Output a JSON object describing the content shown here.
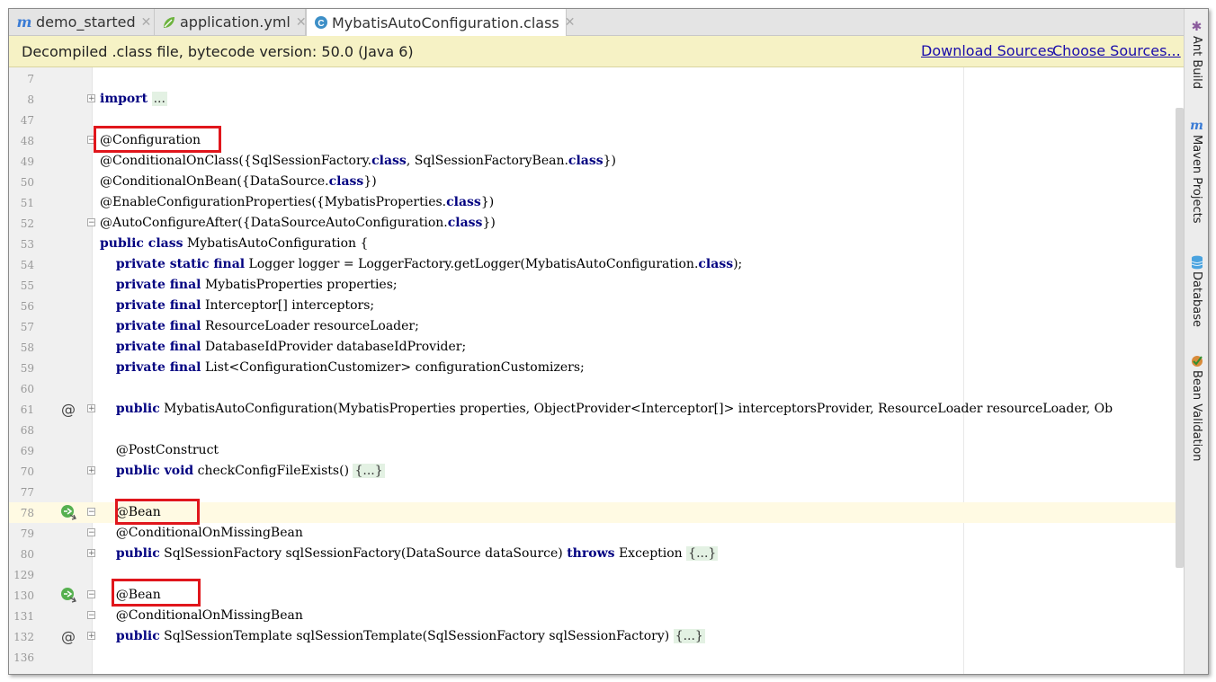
{
  "tabs": [
    {
      "label": "demo_started",
      "icon": "maven-module-icon"
    },
    {
      "label": "application.yml",
      "icon": "spring-config-icon"
    },
    {
      "label": "MybatisAutoConfiguration.class",
      "icon": "class-file-icon"
    }
  ],
  "banner": {
    "message": "Decompiled .class file, bytecode version: 50.0 (Java 6)",
    "download_sources": "Download Sources",
    "choose_sources": "Choose Sources..."
  },
  "right_tools": [
    {
      "label": "Ant Build"
    },
    {
      "label": "Maven Projects"
    },
    {
      "label": "Database"
    },
    {
      "label": "Bean Validation"
    }
  ],
  "lines": [
    {
      "num": "7"
    },
    {
      "num": "8",
      "seg": [
        [
          "kw",
          "import"
        ],
        [
          "p",
          " "
        ],
        [
          "fold",
          "..."
        ]
      ],
      "fold": "+"
    },
    {
      "num": "47"
    },
    {
      "num": "48",
      "seg": [
        [
          "p",
          "@Configuration"
        ]
      ],
      "fold": "-"
    },
    {
      "num": "49",
      "seg": [
        [
          "p",
          "@ConditionalOnClass({SqlSessionFactory."
        ],
        [
          "kw",
          "class"
        ],
        [
          "p",
          ", SqlSessionFactoryBean."
        ],
        [
          "kw",
          "class"
        ],
        [
          "p",
          "})"
        ]
      ]
    },
    {
      "num": "50",
      "seg": [
        [
          "p",
          "@ConditionalOnBean({DataSource."
        ],
        [
          "kw",
          "class"
        ],
        [
          "p",
          "})"
        ]
      ]
    },
    {
      "num": "51",
      "seg": [
        [
          "p",
          "@EnableConfigurationProperties({MybatisProperties."
        ],
        [
          "kw",
          "class"
        ],
        [
          "p",
          "})"
        ]
      ]
    },
    {
      "num": "52",
      "seg": [
        [
          "p",
          "@AutoConfigureAfter({DataSourceAutoConfiguration."
        ],
        [
          "kw",
          "class"
        ],
        [
          "p",
          "})"
        ]
      ],
      "fold": "-"
    },
    {
      "num": "53",
      "seg": [
        [
          "kw",
          "public class"
        ],
        [
          "p",
          " MybatisAutoConfiguration {"
        ]
      ]
    },
    {
      "num": "54",
      "seg": [
        [
          "p",
          "    "
        ],
        [
          "kw",
          "private static final"
        ],
        [
          "p",
          " Logger logger = LoggerFactory.getLogger(MybatisAutoConfiguration."
        ],
        [
          "kw",
          "class"
        ],
        [
          "p",
          ");"
        ]
      ]
    },
    {
      "num": "55",
      "seg": [
        [
          "p",
          "    "
        ],
        [
          "kw",
          "private final"
        ],
        [
          "p",
          " MybatisProperties properties;"
        ]
      ]
    },
    {
      "num": "56",
      "seg": [
        [
          "p",
          "    "
        ],
        [
          "kw",
          "private final"
        ],
        [
          "p",
          " Interceptor[] interceptors;"
        ]
      ]
    },
    {
      "num": "57",
      "seg": [
        [
          "p",
          "    "
        ],
        [
          "kw",
          "private final"
        ],
        [
          "p",
          " ResourceLoader resourceLoader;"
        ]
      ]
    },
    {
      "num": "58",
      "seg": [
        [
          "p",
          "    "
        ],
        [
          "kw",
          "private final"
        ],
        [
          "p",
          " DatabaseIdProvider databaseIdProvider;"
        ]
      ]
    },
    {
      "num": "59",
      "seg": [
        [
          "p",
          "    "
        ],
        [
          "kw",
          "private final"
        ],
        [
          "p",
          " List<ConfigurationCustomizer> configurationCustomizers;"
        ]
      ]
    },
    {
      "num": "60"
    },
    {
      "num": "61",
      "seg": [
        [
          "p",
          "    "
        ],
        [
          "kw",
          "public"
        ],
        [
          "p",
          " MybatisAutoConfiguration(MybatisProperties properties, ObjectProvider<Interceptor[]> interceptorsProvider, ResourceLoader resourceLoader, Ob"
        ]
      ],
      "fold": "+",
      "mark": "@"
    },
    {
      "num": "68"
    },
    {
      "num": "69",
      "seg": [
        [
          "p",
          "    @PostConstruct"
        ]
      ]
    },
    {
      "num": "70",
      "seg": [
        [
          "p",
          "    "
        ],
        [
          "kw",
          "public void"
        ],
        [
          "p",
          " checkConfigFileExists() "
        ],
        [
          "fold",
          "{...}"
        ]
      ],
      "fold": "+"
    },
    {
      "num": "77"
    },
    {
      "num": "78",
      "seg": [
        [
          "p",
          "    @Bean"
        ]
      ],
      "fold": "-",
      "mark": "bean",
      "hl": true
    },
    {
      "num": "79",
      "seg": [
        [
          "p",
          "    @ConditionalOnMissingBean"
        ]
      ],
      "fold": "-"
    },
    {
      "num": "80",
      "seg": [
        [
          "p",
          "    "
        ],
        [
          "kw",
          "public"
        ],
        [
          "p",
          " SqlSessionFactory sqlSessionFactory(DataSource dataSource) "
        ],
        [
          "kw",
          "throws"
        ],
        [
          "p",
          " Exception "
        ],
        [
          "fold",
          "{...}"
        ]
      ],
      "fold": "+"
    },
    {
      "num": "129"
    },
    {
      "num": "130",
      "seg": [
        [
          "p",
          "    @Bean"
        ]
      ],
      "fold": "-",
      "mark": "bean"
    },
    {
      "num": "131",
      "seg": [
        [
          "p",
          "    @ConditionalOnMissingBean"
        ]
      ],
      "fold": "-"
    },
    {
      "num": "132",
      "seg": [
        [
          "p",
          "    "
        ],
        [
          "kw",
          "public"
        ],
        [
          "p",
          " SqlSessionTemplate sqlSessionTemplate(SqlSessionFactory sqlSessionFactory) "
        ],
        [
          "fold",
          "{...}"
        ]
      ],
      "fold": "+",
      "mark": "@"
    },
    {
      "num": "136"
    }
  ],
  "colors": {
    "keyword": "#000080",
    "highlight_box": "#e0161c",
    "banner_bg": "#f6f2c5",
    "caret_line": "#fffae3"
  }
}
